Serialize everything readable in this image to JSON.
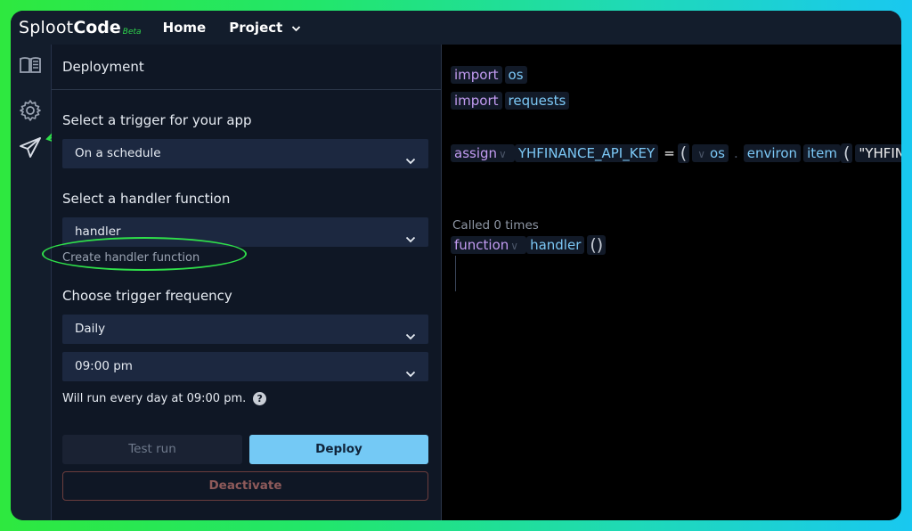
{
  "brand": {
    "name_light": "Sploot",
    "name_bold": "Code",
    "tag": "Beta"
  },
  "nav": {
    "home": "Home",
    "project": "Project"
  },
  "sidebar": {
    "items": [
      "docs",
      "settings",
      "deployment"
    ]
  },
  "panel": {
    "title": "Deployment",
    "trigger_label": "Select a trigger for your app",
    "trigger_value": "On a schedule",
    "handler_label": "Select a handler function",
    "handler_value": "handler",
    "create_handler": "Create handler function",
    "frequency_label": "Choose trigger frequency",
    "frequency_value": "Daily",
    "time_value": "09:00 pm",
    "schedule_note": "Will run every day at 09:00 pm.",
    "help_glyph": "?",
    "test_run": "Test run",
    "deploy": "Deploy",
    "deactivate": "Deactivate"
  },
  "editor": {
    "line1": {
      "kw": "import",
      "name": "os"
    },
    "line2": {
      "kw": "import",
      "name": "requests"
    },
    "line3": {
      "kw": "assign",
      "var": "YHFINANCE_API_KEY",
      "eq": "=",
      "open": "(",
      "mod": "os",
      "dot": ".",
      "attr": "environ",
      "method": "item",
      "open2": "(",
      "str_quote": "\"",
      "str": "YHFIN"
    },
    "called": "Called 0 times",
    "line4": {
      "kw": "function",
      "name": "handler",
      "parens": "()"
    }
  },
  "colors": {
    "accent": "#74c9f5",
    "annotation": "#2fe04a",
    "keyword": "#c39cf2",
    "identifier": "#7cc8f6"
  }
}
